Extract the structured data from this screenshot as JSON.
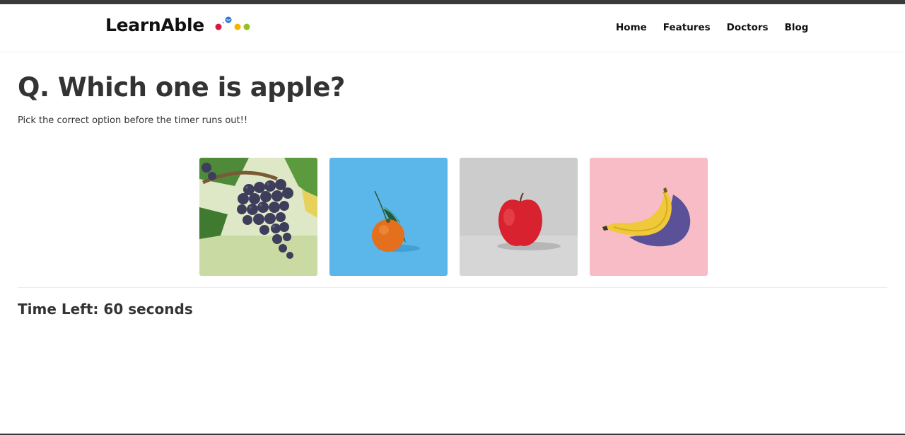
{
  "header": {
    "brand": "LearnAble",
    "logo_colors": [
      "#d8193e",
      "#2f78d6",
      "#f2b600",
      "#95c11f"
    ],
    "nav": [
      {
        "label": "Home"
      },
      {
        "label": "Features"
      },
      {
        "label": "Doctors"
      },
      {
        "label": "Blog"
      }
    ]
  },
  "quiz": {
    "question": "Q. Which one is apple?",
    "instructions": "Pick the correct option before the timer runs out!!",
    "options": [
      {
        "fruit": "grapes",
        "background": "#dfe8c6"
      },
      {
        "fruit": "orange",
        "background": "#5bb7ea"
      },
      {
        "fruit": "apple",
        "background": "#cccccc"
      },
      {
        "fruit": "banana",
        "background": "#f7bcc5"
      }
    ],
    "timer_label": "Time Left:",
    "timer_value": "60",
    "timer_unit": "seconds"
  }
}
